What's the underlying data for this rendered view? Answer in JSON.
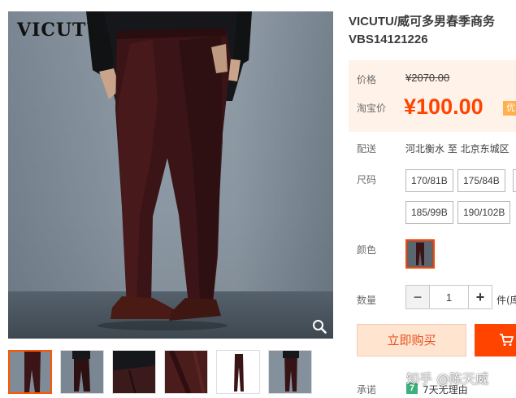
{
  "gallery": {
    "brand_logo": "VICUTU",
    "zoom_icon": "magnifier-icon",
    "thumbnails": [
      {
        "view": "front",
        "selected": true
      },
      {
        "view": "side",
        "selected": false
      },
      {
        "view": "fabric-closeup",
        "selected": false
      },
      {
        "view": "color-closeup",
        "selected": false
      },
      {
        "view": "flat-lay",
        "selected": false
      },
      {
        "view": "back",
        "selected": false
      }
    ]
  },
  "product": {
    "title_line1": "VICUTU/威可多男春季商务",
    "title_line2": "VBS14121226"
  },
  "price": {
    "original_label": "价格",
    "original_value": "¥2070.00",
    "taobao_label": "淘宝价",
    "currency_symbol": "¥",
    "taobao_value": "100.00",
    "promo_tag": "优"
  },
  "shipping": {
    "label": "配送",
    "value": "河北衡水 至  北京东城区"
  },
  "size": {
    "label": "尺码",
    "options": [
      "170/81B",
      "175/84B",
      "185/99B",
      "190/102B"
    ]
  },
  "color": {
    "label": "颜色"
  },
  "quantity": {
    "label": "数量",
    "value": "1",
    "minus": "−",
    "plus": "+",
    "unit_text": "件(库"
  },
  "actions": {
    "buy_now": "立即购买"
  },
  "promise": {
    "label": "承诺",
    "badge": "7",
    "text": "7天无理由"
  },
  "watermark": "知乎 @陈天威",
  "colors": {
    "accent": "#ff4400",
    "price_bg": "#fff2e8",
    "buy_now_bg": "#ffe4d0"
  }
}
